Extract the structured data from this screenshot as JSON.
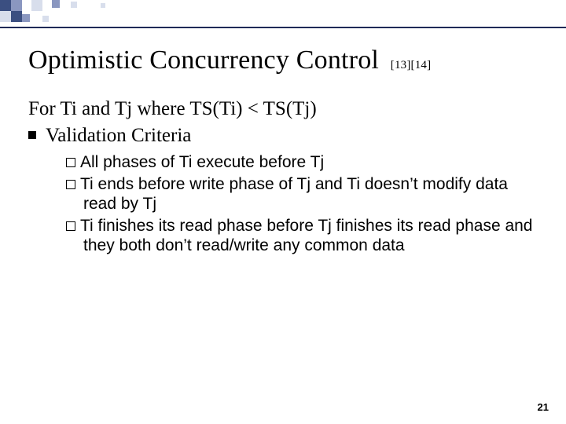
{
  "title": "Optimistic Concurrency Control",
  "title_refs": "[13][14]",
  "body": {
    "intro": "For Ti and Tj where TS(Ti) < TS(Tj)",
    "criteria_label": "Validation Criteria",
    "items": [
      "All phases of Ti execute before Tj",
      "Ti ends before write phase of Tj and Ti doesn’t modify data read by Tj",
      "Ti finishes its read phase before Tj finishes its read phase and they both don’t read/write any common data"
    ]
  },
  "page_number": "21"
}
